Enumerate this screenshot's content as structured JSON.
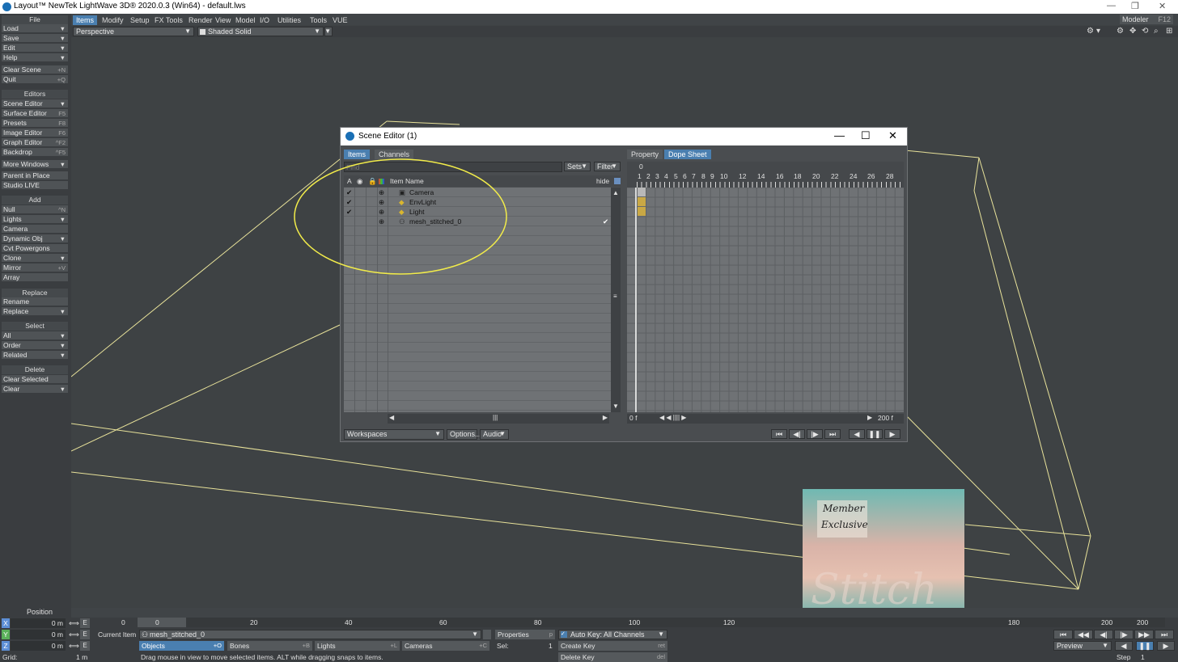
{
  "window": {
    "title": "Layout™ NewTek LightWave 3D® 2020.0.3 (Win64) - default.lws"
  },
  "menu": {
    "tabs": [
      "Items",
      "Modify",
      "Setup",
      "FX Tools",
      "Render",
      "View",
      "Model",
      "I/O",
      "Utilities",
      "Tools",
      "VUE"
    ],
    "modeler": "Modeler",
    "modeler_key": "F12"
  },
  "view": {
    "projection": "Perspective",
    "shading": "Shaded Solid"
  },
  "sidebar": {
    "file_header": "File",
    "load": "Load",
    "save": "Save",
    "edit": "Edit",
    "help": "Help",
    "clear_scene": "Clear Scene",
    "clear_scene_key": "+N",
    "quit": "Quit",
    "quit_key": "+Q",
    "editors_header": "Editors",
    "scene_editor": "Scene Editor",
    "surface_editor": "Surface Editor",
    "surface_editor_key": "F5",
    "presets": "Presets",
    "presets_key": "F8",
    "image_editor": "Image Editor",
    "image_editor_key": "F6",
    "graph_editor": "Graph Editor",
    "graph_editor_key": "^F2",
    "backdrop": "Backdrop",
    "backdrop_key": "^F5",
    "more_windows": "More Windows",
    "parent_in_place": "Parent in Place",
    "studio_live": "Studio LIVE",
    "add_header": "Add",
    "null": "Null",
    "null_key": "^N",
    "lights": "Lights",
    "camera": "Camera",
    "dynamic_obj": "Dynamic Obj",
    "cvt_powergons": "Cvt Powergons",
    "clone": "Clone",
    "mirror": "Mirror",
    "mirror_key": "+V",
    "array": "Array",
    "replace_header": "Replace",
    "rename": "Rename",
    "replace": "Replace",
    "select_header": "Select",
    "all": "All",
    "order": "Order",
    "related": "Related",
    "delete_header": "Delete",
    "clear_selected": "Clear Selected",
    "clear": "Clear"
  },
  "dialog": {
    "title": "Scene Editor (1)",
    "tab_items": "Items",
    "tab_channels": "Channels",
    "find_placeholder": "Find",
    "sets": "Sets",
    "filter": "Filter",
    "col_a": "A",
    "col_item": "Item",
    "col_name": "Name",
    "hide": "hide",
    "rows": [
      {
        "name": "Camera",
        "check": "✔"
      },
      {
        "name": "EnvLight",
        "check": "✔"
      },
      {
        "name": "Light",
        "check": "✔"
      },
      {
        "name": "mesh_stitched_0",
        "check": ""
      }
    ],
    "mesh_check": "✔",
    "tab_property": "Property",
    "tab_dopesheet": "Dope Sheet",
    "ruler_zero": "0",
    "ruler": [
      "1",
      "2",
      "3",
      "4",
      "5",
      "6",
      "7",
      "8",
      "9",
      "10",
      "12",
      "14",
      "16",
      "18",
      "20",
      "22",
      "24",
      "26",
      "28"
    ],
    "frame_start": "0 f",
    "frame_end": "200 f",
    "workspaces": "Workspaces",
    "options": "Options...",
    "audio": "Audio"
  },
  "overlay": {
    "line1": "Member",
    "line2": "Exclusive",
    "big": "Stitch"
  },
  "bottom": {
    "position_label": "Position",
    "x_label": "X",
    "y_label": "Y",
    "z_label": "Z",
    "x_val": "0 m",
    "y_val": "0 m",
    "z_val": "0 m",
    "e": "E",
    "grid_label": "Grid:",
    "grid_val": "1 m",
    "timeline_start": "0",
    "timeline_ticks": [
      "0",
      "20",
      "40",
      "60",
      "80",
      "100",
      "120",
      "180",
      "200"
    ],
    "timeline_end": "200",
    "current_item_label": "Current Item",
    "current_item": "mesh_stitched_0",
    "objects": "Objects",
    "objects_key": "+O",
    "bones": "Bones",
    "bones_key": "+B",
    "lights": "Lights",
    "lights_key": "+L",
    "cameras": "Cameras",
    "cameras_key": "+C",
    "properties": "Properties",
    "properties_key": "p",
    "sel_label": "Sel:",
    "sel_val": "1",
    "autokey": "Auto Key: All Channels",
    "create_key": "Create Key",
    "create_key_key": "ret",
    "delete_key": "Delete Key",
    "delete_key_key": "del",
    "preview": "Preview",
    "step_label": "Step",
    "step_val": "1",
    "status": "Drag mouse in view to move selected items. ALT while dragging snaps to items."
  },
  "colors": {
    "accent": "#4a7fb0",
    "wire": "#e8e29a",
    "circle": "#f2ec4a",
    "key": "#c9a845"
  }
}
